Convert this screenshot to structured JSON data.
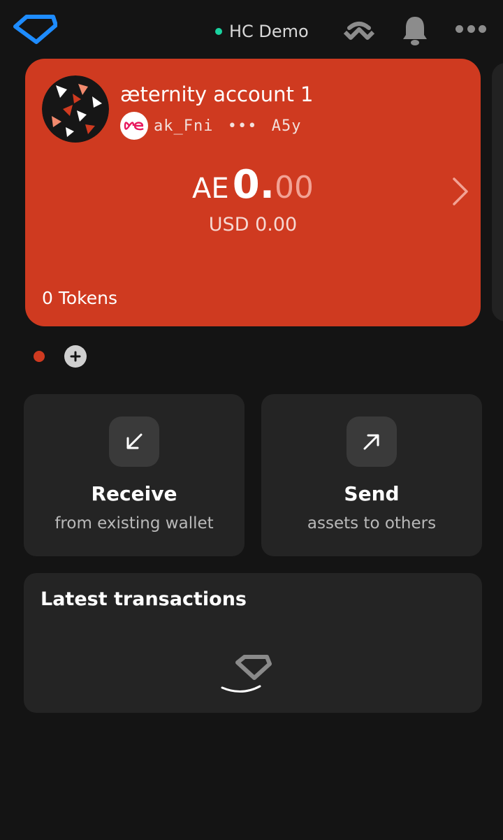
{
  "header": {
    "network_name": "HC Demo",
    "network_status_color": "#1ad3a0",
    "icons": [
      "superhero-logo-icon",
      "walletconnect-icon",
      "bell-icon",
      "more-icon"
    ]
  },
  "account": {
    "name": "æternity account 1",
    "address_start": "ak_Fni",
    "address_dots": "•••",
    "address_end": "A5y",
    "balance_currency": "AE",
    "balance_integer": "0.",
    "balance_decimals": "00",
    "fiat_balance": "USD 0.00",
    "tokens": "0 Tokens",
    "card_color": "#cf3a20"
  },
  "actions": {
    "receive": {
      "title": "Receive",
      "subtitle": "from existing wallet"
    },
    "send": {
      "title": "Send",
      "subtitle": "assets to others"
    }
  },
  "transactions": {
    "title": "Latest transactions"
  }
}
